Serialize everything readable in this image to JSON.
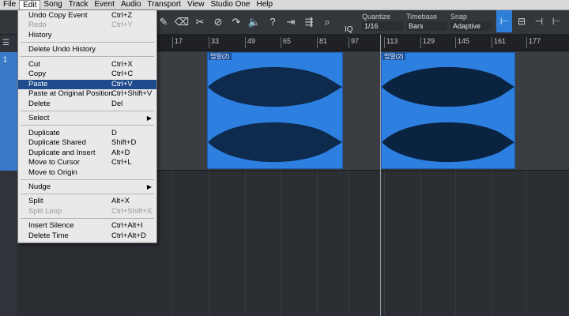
{
  "menubar": {
    "items": [
      "File",
      "Song",
      "Track",
      "Event",
      "Audio",
      "Transport",
      "View",
      "Studio One",
      "Help"
    ],
    "active": "Edit"
  },
  "edit_menu": {
    "items": [
      {
        "label": "Undo Copy Event",
        "shortcut": "Ctrl+Z"
      },
      {
        "label": "Redo",
        "shortcut": "Ctrl+Y",
        "disabled": true
      },
      {
        "label": "History",
        "shortcut": ""
      },
      {
        "label": "Delete Undo History",
        "shortcut": ""
      },
      {
        "label": "Cut",
        "shortcut": "Ctrl+X"
      },
      {
        "label": "Copy",
        "shortcut": "Ctrl+C"
      },
      {
        "label": "Paste",
        "shortcut": "Ctrl+V",
        "selected": true
      },
      {
        "label": "Paste at Original Position",
        "shortcut": "Ctrl+Shift+V"
      },
      {
        "label": "Delete",
        "shortcut": "Del"
      },
      {
        "label": "Select",
        "shortcut": "",
        "submenu": true
      },
      {
        "label": "Duplicate",
        "shortcut": "D"
      },
      {
        "label": "Duplicate Shared",
        "shortcut": "Shift+D"
      },
      {
        "label": "Duplicate and Insert",
        "shortcut": "Alt+D"
      },
      {
        "label": "Move to Cursor",
        "shortcut": "Ctrl+L"
      },
      {
        "label": "Move to Origin",
        "shortcut": ""
      },
      {
        "label": "Nudge",
        "shortcut": "",
        "submenu": true
      },
      {
        "label": "Split",
        "shortcut": "Alt+X"
      },
      {
        "label": "Split Loop",
        "shortcut": "Ctrl+Shift+X",
        "disabled": true
      },
      {
        "label": "Insert Silence",
        "shortcut": "Ctrl+Alt+I"
      },
      {
        "label": "Delete Time",
        "shortcut": "Ctrl+Alt+D"
      }
    ]
  },
  "toolbar": {
    "iq_label": "IQ",
    "quantize": {
      "label": "Quantize",
      "value": "1/16"
    },
    "timebase": {
      "label": "Timebase",
      "value": "Bars"
    },
    "snap": {
      "label": "Snap",
      "value": "Adaptive"
    },
    "icons": [
      "pencil-icon",
      "eraser-icon",
      "split-icon",
      "mute-icon",
      "bend-icon",
      "listen-icon",
      "help-icon",
      "scroll-icon",
      "zoom-follow-icon",
      "zoom-icon"
    ]
  },
  "ruler": {
    "ticks": [
      "17",
      "33",
      "49",
      "65",
      "81",
      "97",
      "113",
      "129",
      "145",
      "161",
      "177"
    ]
  },
  "track": {
    "number": "1"
  },
  "clips": [
    {
      "name": "엄말(2)"
    },
    {
      "name": "엄말(2)"
    }
  ],
  "colors": {
    "clip_fill": "#2d7fe0",
    "waveform_dark": "#0e2a4d",
    "menu_selected": "#1f4a8c",
    "snap_active": "#2f7fd8"
  }
}
